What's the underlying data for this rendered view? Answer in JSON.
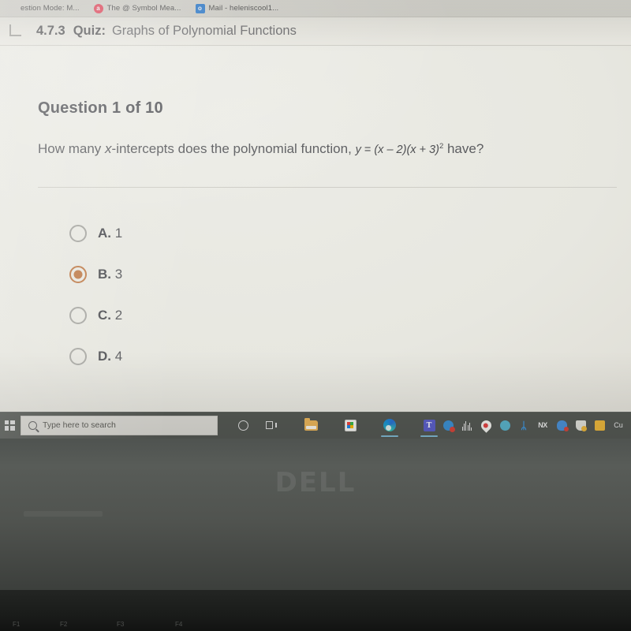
{
  "browser": {
    "tabs": [
      {
        "title": "estion Mode: M...",
        "favicon": "none-icon"
      },
      {
        "title": "The @ Symbol Mea...",
        "favicon": "answers-a-icon"
      },
      {
        "title": "Mail - heleniscool1...",
        "favicon": "mail-icon"
      }
    ]
  },
  "header": {
    "back_icon": "back-arrow-icon",
    "lesson_number": "4.7.3",
    "quiz_word": "Quiz:",
    "quiz_title": "Graphs of Polynomial Functions"
  },
  "quiz": {
    "question_counter": "Question 1 of 10",
    "question_prefix": "How many ",
    "question_italic": "x",
    "question_middle": "-intercepts does the polynomial function,",
    "equation": {
      "lhs": "y",
      "equals": "=",
      "factor1": "(x – 2)",
      "factor2": "(x + 3)",
      "exponent": "2"
    },
    "question_suffix": "have?",
    "selected_option": "B",
    "options": [
      {
        "key": "A.",
        "value": "1",
        "selected": false
      },
      {
        "key": "B.",
        "value": "3",
        "selected": true
      },
      {
        "key": "C.",
        "value": "2",
        "selected": false
      },
      {
        "key": "D.",
        "value": "4",
        "selected": false
      }
    ]
  },
  "taskbar": {
    "start_icon": "windows-start-icon",
    "search_placeholder": "Type here to search",
    "search_value": "",
    "search_icon": "search-icon",
    "items": [
      {
        "name": "cortana-icon",
        "label": "Cortana"
      },
      {
        "name": "task-view-icon",
        "label": "Task View"
      },
      {
        "name": "file-explorer-icon",
        "label": "File Explorer"
      },
      {
        "name": "microsoft-store-icon",
        "label": "Microsoft Store"
      },
      {
        "name": "microsoft-edge-icon",
        "label": "Microsoft Edge"
      },
      {
        "name": "microsoft-teams-icon",
        "label": "Microsoft Teams"
      }
    ],
    "tray": [
      {
        "name": "sync-error-icon"
      },
      {
        "name": "audio-equalizer-icon"
      },
      {
        "name": "water-drop-icon"
      },
      {
        "name": "globe-icon"
      },
      {
        "name": "bluetooth-icon",
        "glyph": "ᛦ"
      },
      {
        "name": "network-disconnected-icon",
        "glyph": "NX"
      },
      {
        "name": "onedrive-error-icon"
      },
      {
        "name": "security-warning-icon"
      },
      {
        "name": "warning-icon"
      },
      {
        "name": "language-icon",
        "glyph": "Cu"
      }
    ]
  },
  "device": {
    "brand_logo": "DELL",
    "function_keys": [
      "F1",
      "F2",
      "F3",
      "F4"
    ]
  },
  "colors": {
    "page_background": "#e9e8e1",
    "text_primary": "#55565a",
    "text_secondary": "#6b6b6d",
    "accent_selected_radio": "#c08050",
    "radio_unselected": "#a9a9a4",
    "taskbar": "#545853",
    "divider": "#cfcec7"
  }
}
